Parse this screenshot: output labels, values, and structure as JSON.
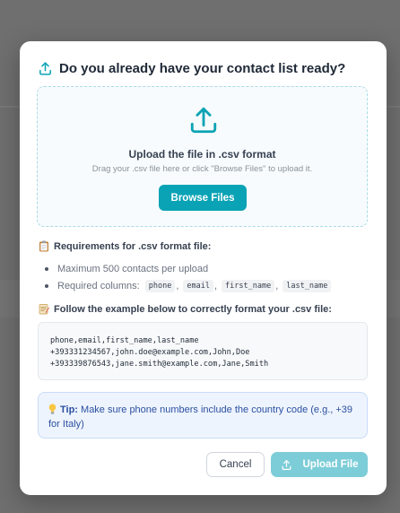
{
  "colors": {
    "accent": "#0aa3b5",
    "accent_disabled": "#7dcdd8",
    "tip_bg": "#eef4fe",
    "tip_text": "#2a4fa0"
  },
  "modal": {
    "title": "Do you already have your contact list ready?",
    "title_icon": "upload-icon",
    "dropzone": {
      "icon": "upload-icon",
      "title": "Upload the file in .csv format",
      "subtitle": "Drag your .csv file here or click \"Browse Files\" to upload it.",
      "browse_label": "Browse Files"
    },
    "requirements": {
      "icon": "clipboard-icon",
      "heading": "Requirements for .csv format file:",
      "max_contacts": "Maximum 500 contacts per upload",
      "columns_label": "Required columns:",
      "columns": [
        "phone",
        "email",
        "first_name",
        "last_name"
      ]
    },
    "example": {
      "icon": "memo-icon",
      "heading": "Follow the example below to correctly format your .csv file:",
      "lines": [
        "phone,email,first_name,last_name",
        "+393331234567,john.doe@example.com,John,Doe",
        "+393339876543,jane.smith@example.com,Jane,Smith"
      ]
    },
    "tip": {
      "icon": "lightbulb-icon",
      "label": "Tip:",
      "text": "Make sure phone numbers include the country code (e.g., +39 for Italy)"
    },
    "buttons": {
      "cancel": "Cancel",
      "upload": "Upload File",
      "upload_icon": "upload-icon"
    }
  }
}
